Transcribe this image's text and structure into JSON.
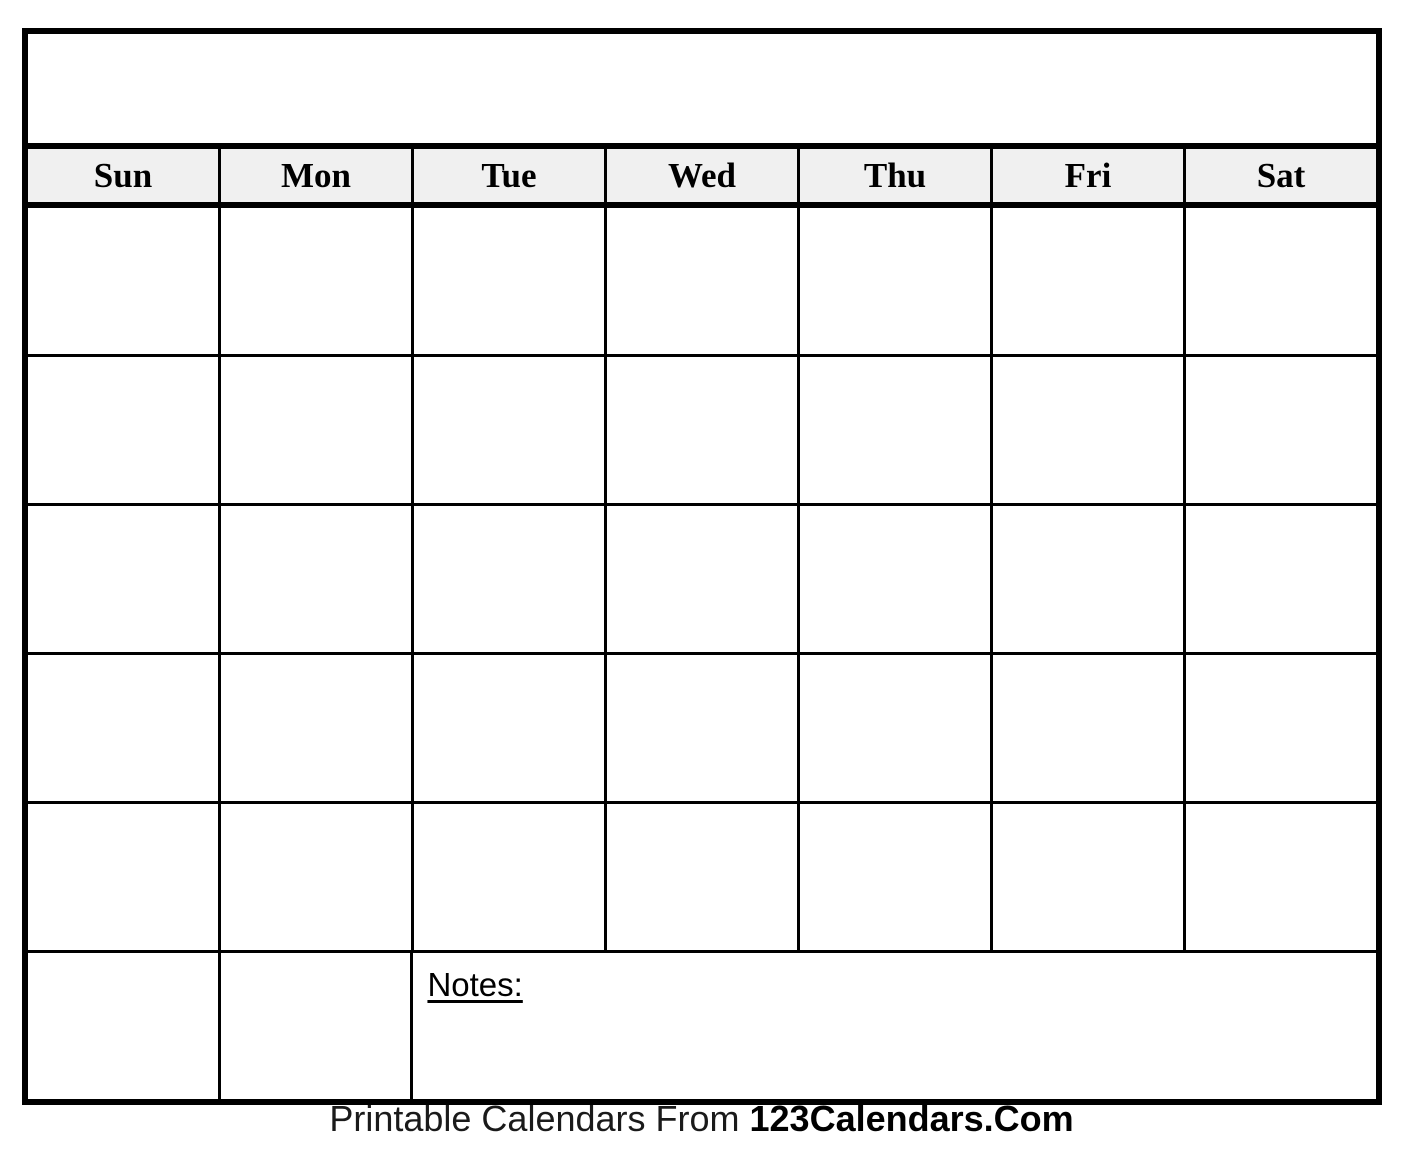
{
  "calendar": {
    "title": "",
    "weekdays": [
      {
        "label": "Sun"
      },
      {
        "label": "Mon"
      },
      {
        "label": "Tue"
      },
      {
        "label": "Wed"
      },
      {
        "label": "Thu"
      },
      {
        "label": "Fri"
      },
      {
        "label": "Sat"
      }
    ],
    "weeks": [
      {
        "days": [
          "",
          "",
          "",
          "",
          "",
          "",
          ""
        ]
      },
      {
        "days": [
          "",
          "",
          "",
          "",
          "",
          "",
          ""
        ]
      },
      {
        "days": [
          "",
          "",
          "",
          "",
          "",
          "",
          ""
        ]
      },
      {
        "days": [
          "",
          "",
          "",
          "",
          "",
          "",
          ""
        ]
      },
      {
        "days": [
          "",
          "",
          "",
          "",
          "",
          "",
          ""
        ]
      }
    ],
    "last_row": {
      "days": [
        "",
        ""
      ],
      "notes_label": "Notes:",
      "notes_value": ""
    }
  },
  "footer": {
    "prefix": "Printable Calendars From ",
    "brand": "123Calendars.Com"
  },
  "colors": {
    "border": "#000000",
    "header_background": "#f0f0f0",
    "page_background": "#ffffff",
    "text": "#000000"
  }
}
